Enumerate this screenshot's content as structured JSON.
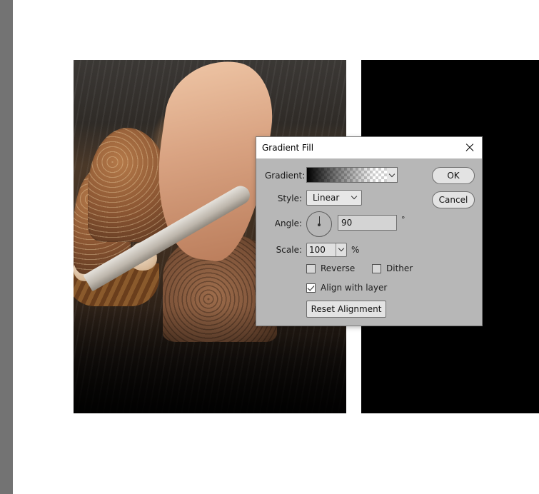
{
  "dialog": {
    "title": "Gradient Fill",
    "labels": {
      "gradient": "Gradient:",
      "style": "Style:",
      "angle": "Angle:",
      "scale": "Scale:"
    },
    "style_value": "Linear",
    "angle_value": "90",
    "angle_unit": "°",
    "scale_value": "100",
    "scale_unit": "%",
    "checkboxes": {
      "reverse": {
        "label": "Reverse",
        "checked": false
      },
      "dither": {
        "label": "Dither",
        "checked": false
      },
      "align_with_layer": {
        "label": "Align with layer",
        "checked": true
      }
    },
    "buttons": {
      "reset_alignment": "Reset Alignment",
      "ok": "OK",
      "cancel": "Cancel"
    }
  },
  "colors": {
    "left_panel": "#737373",
    "canvas": "#ffffff",
    "dialog_bg": "#b7b7b7",
    "layer_black": "#000000"
  }
}
